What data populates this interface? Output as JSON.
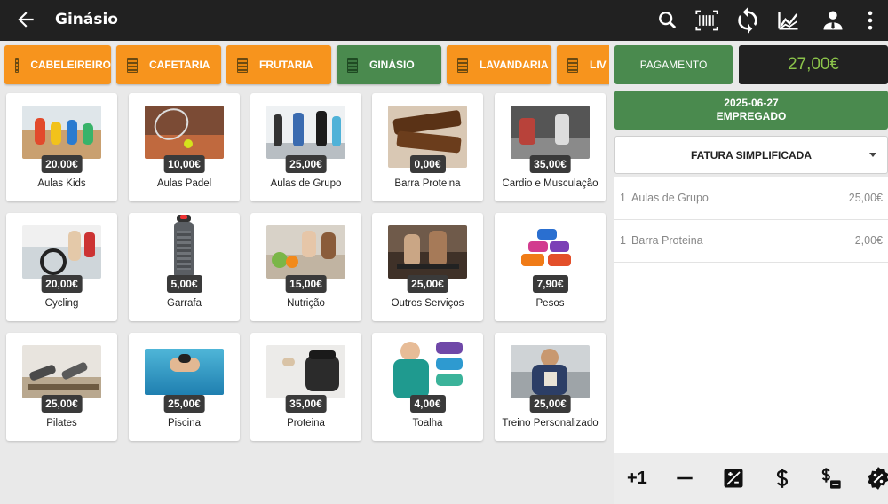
{
  "appbar": {
    "title": "Ginásio",
    "icons": [
      "back-arrow-icon",
      "search-icon",
      "barcode-icon",
      "sync-icon",
      "chart-icon",
      "user-icon",
      "more-vert-icon"
    ]
  },
  "categories": [
    {
      "label": "CABELEIREIRO",
      "active": false
    },
    {
      "label": "CAFETARIA",
      "active": false
    },
    {
      "label": "FRUTARIA",
      "active": false
    },
    {
      "label": "GINÁSIO",
      "active": true
    },
    {
      "label": "LAVANDARIA",
      "active": false
    },
    {
      "label": "LIV",
      "active": false
    }
  ],
  "products": [
    {
      "name": "Aulas Kids",
      "price": "20,00€"
    },
    {
      "name": "Aulas Padel",
      "price": "10,00€"
    },
    {
      "name": "Aulas de Grupo",
      "price": "25,00€"
    },
    {
      "name": "Barra Proteina",
      "price": "0,00€"
    },
    {
      "name": "Cardio e Musculação",
      "price": "35,00€"
    },
    {
      "name": "Cycling",
      "price": "20,00€"
    },
    {
      "name": "Garrafa",
      "price": "5,00€"
    },
    {
      "name": "Nutrição",
      "price": "15,00€"
    },
    {
      "name": "Outros Serviços",
      "price": "25,00€"
    },
    {
      "name": "Pesos",
      "price": "7,90€"
    },
    {
      "name": "Pilates",
      "price": "25,00€"
    },
    {
      "name": "Piscina",
      "price": "25,00€"
    },
    {
      "name": "Proteina",
      "price": "35,00€"
    },
    {
      "name": "Toalha",
      "price": "4,00€"
    },
    {
      "name": "Treino Personalizado",
      "price": "25,00€"
    }
  ],
  "panel": {
    "payment_label": "PAGAMENTO",
    "total": "27,00€",
    "date": "2025-06-27",
    "employee": "EMPREGADO",
    "document_type": "FATURA SIMPLIFICADA"
  },
  "ticket_lines": [
    {
      "qty": "1",
      "desc": "Aulas de Grupo",
      "amount": "25,00€"
    },
    {
      "qty": "1",
      "desc": "Barra Proteina",
      "amount": "2,00€"
    }
  ],
  "bottombar": {
    "plus_one": "+1",
    "icons": [
      "minus-icon",
      "edit-price-icon",
      "dollar-icon",
      "price-list-icon",
      "discount-icon"
    ]
  },
  "colors": {
    "accent_green": "#4a8a4e",
    "category_orange": "#f7941d",
    "appbar": "#212121",
    "total_text": "#8bc34a"
  }
}
